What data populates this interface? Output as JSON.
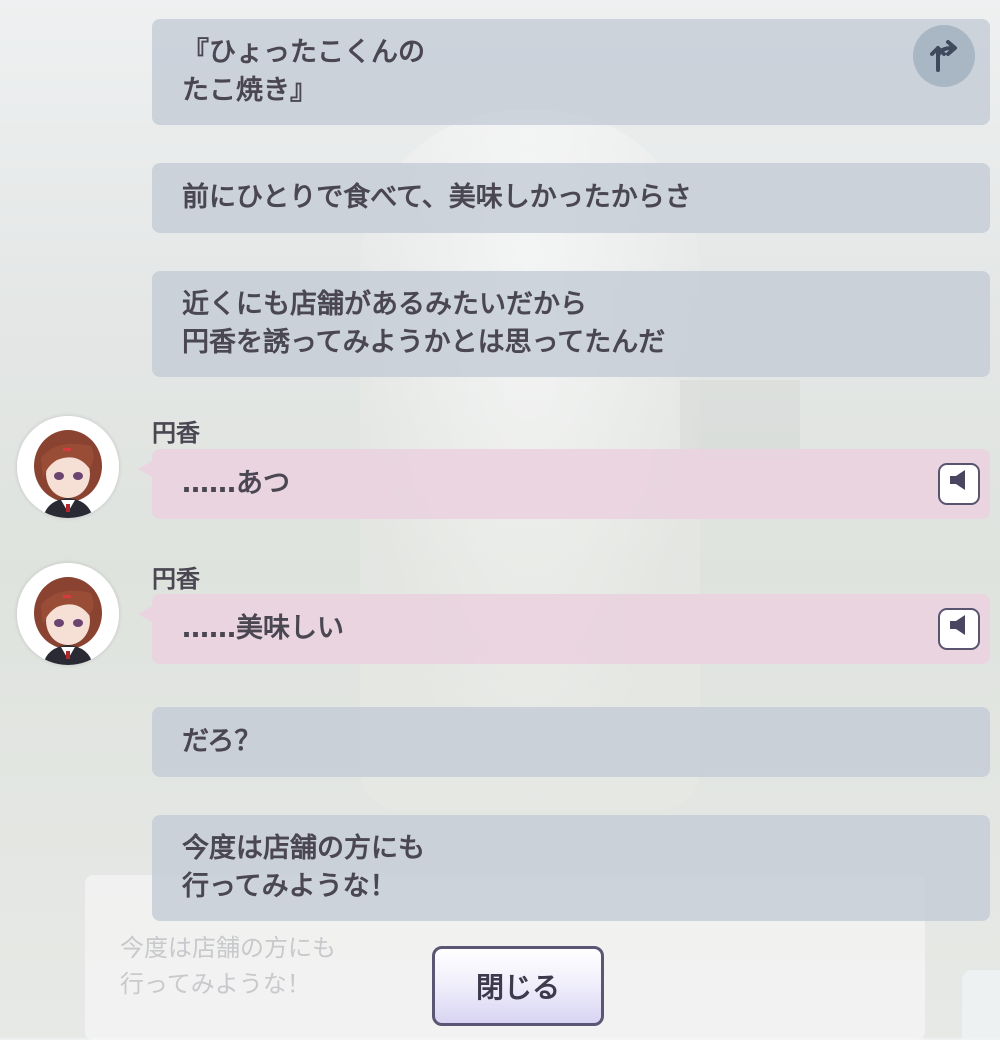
{
  "messages": [
    {
      "type": "narration",
      "text": "『ひょったこくんの\nたこ焼き』"
    },
    {
      "type": "narration",
      "text": "前にひとりで食べて、美味しかったからさ"
    },
    {
      "type": "narration",
      "text": "近くにも店舗があるみたいだから\n円香を誘ってみようかとは思ってたんだ"
    },
    {
      "type": "character",
      "speaker": "円香",
      "text": "……あつ"
    },
    {
      "type": "character",
      "speaker": "円香",
      "text": "……美味しい"
    },
    {
      "type": "narration",
      "text": "だろ？"
    },
    {
      "type": "narration",
      "text": "今度は店舗の方にも\n行ってみような！"
    }
  ],
  "background": {
    "faded_text": "今度は店舗の方にも\n行ってみような！"
  },
  "controls": {
    "close_label": "閉じる",
    "branch_icon": "branch-arrow-icon",
    "voice_icon": "speaker-icon"
  },
  "colors": {
    "narration_bubble": "#c3cbd5",
    "character_bubble": "#e9d2df",
    "text": "#4a4752",
    "accent": "#5b5674"
  }
}
